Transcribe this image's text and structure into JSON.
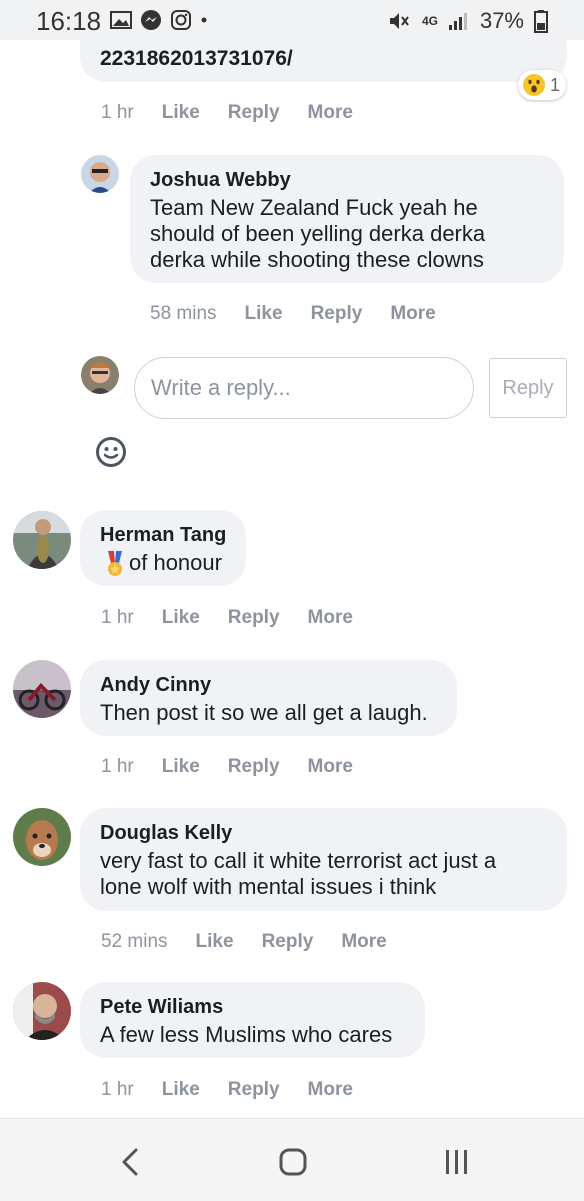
{
  "status_bar": {
    "time": "16:18",
    "network": "4G",
    "battery": "37%"
  },
  "top_comment": {
    "text": "2231862013731076/",
    "reaction_count": "1",
    "actions": {
      "time": "1 hr",
      "like": "Like",
      "reply": "Reply",
      "more": "More"
    }
  },
  "reply_comment": {
    "name": "Joshua Webby",
    "text": "Team New Zealand Fuck yeah he\nshould of been yelling derka derka\nderka while shooting these clowns",
    "actions": {
      "time": "58 mins",
      "like": "Like",
      "reply": "Reply",
      "more": "More"
    }
  },
  "composer": {
    "placeholder": "Write a reply...",
    "button": "Reply"
  },
  "comments": [
    {
      "name": "Herman Tang",
      "text": "of honour",
      "actions": {
        "time": "1 hr",
        "like": "Like",
        "reply": "Reply",
        "more": "More"
      }
    },
    {
      "name": "Andy Cinny",
      "text": "Then post it so we all get a laugh.",
      "actions": {
        "time": "1 hr",
        "like": "Like",
        "reply": "Reply",
        "more": "More"
      }
    },
    {
      "name": "Douglas Kelly",
      "text": "very fast to call it white terrorist act just a\nlone wolf with mental issues i think",
      "actions": {
        "time": "52 mins",
        "like": "Like",
        "reply": "Reply",
        "more": "More"
      }
    },
    {
      "name": "Pete Wiliams",
      "text": "A few less Muslims who cares",
      "actions": {
        "time": "1 hr",
        "like": "Like",
        "reply": "Reply",
        "more": "More"
      }
    }
  ],
  "icons": {
    "reaction": "wow-reaction-icon",
    "medal": "medal-emoji-icon",
    "emoji_picker": "smiley-icon",
    "nav_back": "back-chevron-icon",
    "nav_home": "home-circle-icon",
    "nav_recents": "recents-icon"
  },
  "colors": {
    "bubble": "#f0f2f5",
    "muted": "#8d949e",
    "text": "#1c1e21"
  }
}
